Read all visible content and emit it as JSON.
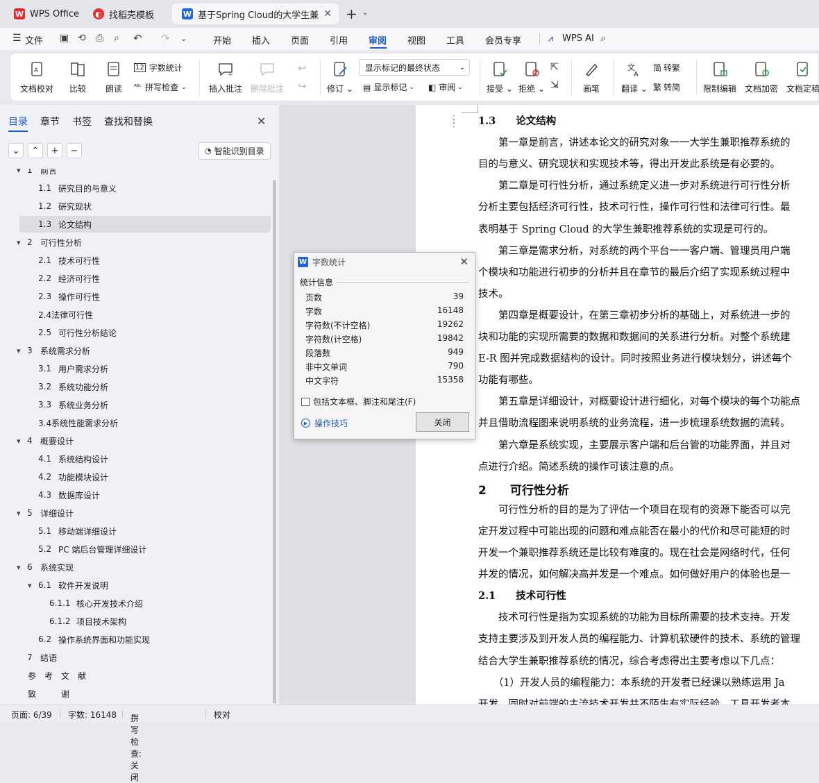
{
  "tabs": [
    {
      "label": "WPS Office"
    },
    {
      "label": "找稻壳模板"
    },
    {
      "label": "基于Spring Cloud的大学生兼"
    }
  ],
  "menu": {
    "file": "文件",
    "items": [
      "开始",
      "插入",
      "页面",
      "引用",
      "审阅",
      "视图",
      "工具",
      "会员专享"
    ],
    "ai": "WPS AI"
  },
  "ribbon": {
    "doc_check": "文档校对",
    "compare": "比较",
    "read": "朗读",
    "word_count": "字数统计",
    "spell_check": "拼写检查",
    "insert_comment": "插入批注",
    "delete_comment": "删除批注",
    "revise": "修订",
    "markup_state": "显示标记的最终状态",
    "show_markup": "显示标记",
    "review_pane": "审阅",
    "accept": "接受",
    "reject": "拒绝",
    "pen": "画笔",
    "translate": "翻译",
    "to_traditional": "转繁",
    "to_simplified": "转简",
    "restrict_edit": "限制编辑",
    "encrypt": "文档加密",
    "finalize": "文档定稿"
  },
  "left_panel": {
    "tabs": [
      "目录",
      "章节",
      "书签",
      "查找和替换"
    ],
    "smart_toc": "智能识别目录",
    "toc": [
      {
        "num": "1",
        "text": "前言",
        "level": 1,
        "arrow": true
      },
      {
        "num": "1.1",
        "text": "研究目的与意义",
        "level": 2
      },
      {
        "num": "1.2",
        "text": "研究现状",
        "level": 2
      },
      {
        "num": "1.3",
        "text": "论文结构",
        "level": 2,
        "selected": true
      },
      {
        "num": "2",
        "text": "可行性分析",
        "level": 1,
        "arrow": true
      },
      {
        "num": "2.1",
        "text": "技术可行性",
        "level": 2
      },
      {
        "num": "2.2",
        "text": "经济可行性",
        "level": 2
      },
      {
        "num": "2.3",
        "text": "操作可行性",
        "level": 2
      },
      {
        "num": "",
        "text": "2.4法律可行性",
        "level": 2
      },
      {
        "num": "2.5",
        "text": "可行性分析结论",
        "level": 2
      },
      {
        "num": "3",
        "text": "系统需求分析",
        "level": 1,
        "arrow": true
      },
      {
        "num": "3.1",
        "text": "用户需求分析",
        "level": 2
      },
      {
        "num": "3.2",
        "text": "系统功能分析",
        "level": 2
      },
      {
        "num": "3.3",
        "text": "系统业务分析",
        "level": 2
      },
      {
        "num": "",
        "text": "3.4系统性能需求分析",
        "level": 2
      },
      {
        "num": "4",
        "text": "概要设计",
        "level": 1,
        "arrow": true
      },
      {
        "num": "4.1",
        "text": "系统结构设计",
        "level": 2
      },
      {
        "num": "4.2",
        "text": "功能模块设计",
        "level": 2
      },
      {
        "num": "4.3",
        "text": "数据库设计",
        "level": 2
      },
      {
        "num": "5",
        "text": "详细设计",
        "level": 1,
        "arrow": true
      },
      {
        "num": "5.1",
        "text": "移动端详细设计",
        "level": 2
      },
      {
        "num": "5.2",
        "text": "PC 端后台管理详细设计",
        "level": 2
      },
      {
        "num": "6",
        "text": "系统实现",
        "level": 1,
        "arrow": true
      },
      {
        "num": "6.1",
        "text": "软件开发说明",
        "level": 2,
        "arrow": true
      },
      {
        "num": "6.1.1",
        "text": "核心开发技术介绍",
        "level": 3
      },
      {
        "num": "6.1.2",
        "text": "项目技术架构",
        "level": 3
      },
      {
        "num": "6.2",
        "text": "操作系统界面和功能实现",
        "level": 2
      },
      {
        "num": "7",
        "text": "结语",
        "level": 1
      },
      {
        "num": "",
        "text": "参　考　文　献",
        "level": 1
      },
      {
        "num": "",
        "text": "致　　　谢",
        "level": 1
      }
    ]
  },
  "document": {
    "lines": [
      {
        "t": "1.3　　论文结构",
        "kind": "h2"
      },
      {
        "t": "　　第一章是前言，讲述本论文的研究对象一一大学生兼职推荐系统的",
        "kind": "p"
      },
      {
        "t": "目的与意义、研究现状和实现技术等，得出开发此系统是有必要的。",
        "kind": "p"
      },
      {
        "t": "　　第二章是可行性分析，通过系统定义进一步对系统进行可行性分析",
        "kind": "p"
      },
      {
        "t": "分析主要包括经济可行性，技术可行性，操作可行性和法律可行性。最",
        "kind": "p"
      },
      {
        "t": "表明基于 Spring Cloud 的大学生兼职推荐系统的实现是可行的。",
        "kind": "p"
      },
      {
        "t": "　　第三章是需求分析，对系统的两个平台一一客户端、管理员用户端",
        "kind": "p"
      },
      {
        "t": "个模块和功能进行初步的分析并且在章节的最后介绍了实现系统过程中",
        "kind": "p"
      },
      {
        "t": "技术。",
        "kind": "p"
      },
      {
        "t": "　　第四章是概要设计，在第三章初步分析的基础上，对系统进一步的",
        "kind": "p"
      },
      {
        "t": "块和功能的实现所需要的数据和数据间的关系进行分析。对整个系统建",
        "kind": "p"
      },
      {
        "t": "E-R 图并完成数据结构的设计。同时按照业务进行模块划分，讲述每个",
        "kind": "p"
      },
      {
        "t": "功能有哪些。",
        "kind": "p"
      },
      {
        "t": "　　第五章是详细设计，对概要设计进行细化，对每个模块的每个功能点",
        "kind": "p"
      },
      {
        "t": "并且借助流程图来说明系统的业务流程，进一步梳理系统数据的流转。",
        "kind": "p"
      },
      {
        "t": "　　第六章是系统实现，主要展示客户端和后台管的功能界面，并且对",
        "kind": "p"
      },
      {
        "t": "点进行介绍。简述系统的操作可该注意的点。",
        "kind": "p"
      },
      {
        "t": "2　　可行性分析",
        "kind": "h1"
      },
      {
        "t": "　　可行性分析的目的是为了评估一个项目在现有的资源下能否可以完",
        "kind": "p"
      },
      {
        "t": "定开发过程中可能出现的问题和难点能否在最小的代价和尽可能短的时",
        "kind": "p"
      },
      {
        "t": "开发一个兼职推荐系统还是比较有难度的。现在社会是网络时代，任何",
        "kind": "p"
      },
      {
        "t": "并发的情况，如何解决高并发是一个难点。如何做好用户的体验也是一",
        "kind": "p"
      },
      {
        "t": "2.1　　技术可行性",
        "kind": "h2"
      },
      {
        "t": "　　技术可行性是指为实现系统的功能为目标所需要的技术支持。开发",
        "kind": "p"
      },
      {
        "t": "支持主要涉及到开发人员的编程能力、计算机软硬件的技术、系统的管理",
        "kind": "p"
      },
      {
        "t": "结合大学生兼职推荐系统的情况，综合考虑得出主要考虑以下几点：",
        "kind": "p"
      },
      {
        "t": "　　（1）开发人员的编程能力：本系统的开发者已经课以熟练运用 Ja",
        "kind": "p"
      },
      {
        "t": "开发，同时对前端的主流技术开发并不陌生有实际经验，工具开发者本",
        "kind": "p"
      }
    ]
  },
  "dialog": {
    "title": "字数统计",
    "section": "统计信息",
    "rows": [
      {
        "label": "页数",
        "value": "39"
      },
      {
        "label": "字数",
        "value": "16148"
      },
      {
        "label": "字符数(不计空格)",
        "value": "19262"
      },
      {
        "label": "字符数(计空格)",
        "value": "19842"
      },
      {
        "label": "段落数",
        "value": "949"
      },
      {
        "label": "非中文单词",
        "value": "790"
      },
      {
        "label": "中文字符",
        "value": "15358"
      }
    ],
    "checkbox": "包括文本框、脚注和尾注(F)",
    "tips": "操作技巧",
    "close": "关闭"
  },
  "status": {
    "page": "页面: 6/39",
    "words": "字数: 16148",
    "spell": "拼写检查: 关闭",
    "proof": "校对"
  }
}
